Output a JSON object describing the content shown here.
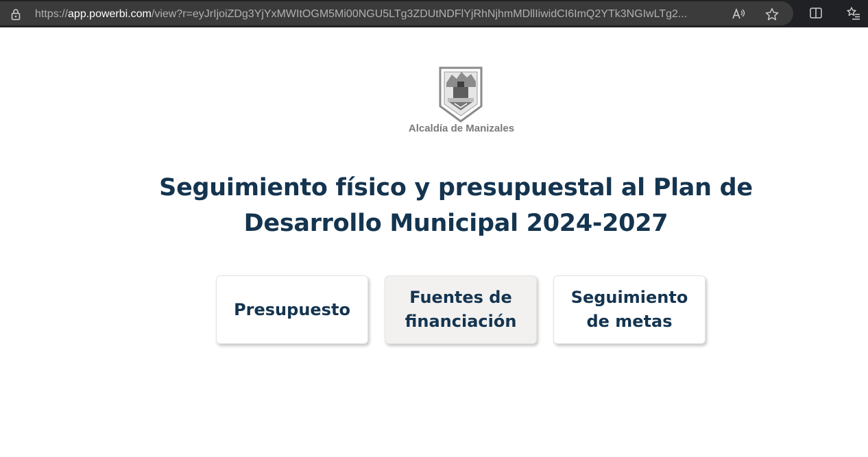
{
  "browser": {
    "url_prefix": "https://",
    "url_host": "app.powerbi.com",
    "url_rest": "/view?r=eyJrIjoiZDg3YjYxMWItOGM5Mi00NGU5LTg3ZDUtNDFlYjRhNjhmMDllIiwidCI6ImQ2YTk3NGIwLTg2..."
  },
  "report": {
    "org_name": "Alcaldía de Manizales",
    "title": "Seguimiento físico y presupuestal al Plan de Desarrollo Municipal 2024-2027",
    "buttons": [
      {
        "label": "Presupuesto"
      },
      {
        "label": "Fuentes de financiación"
      },
      {
        "label": "Seguimiento de metas"
      }
    ]
  },
  "colors": {
    "title": "#14344f",
    "active_button_bg": "#f2f1f0",
    "browser_bar": "#202124"
  }
}
